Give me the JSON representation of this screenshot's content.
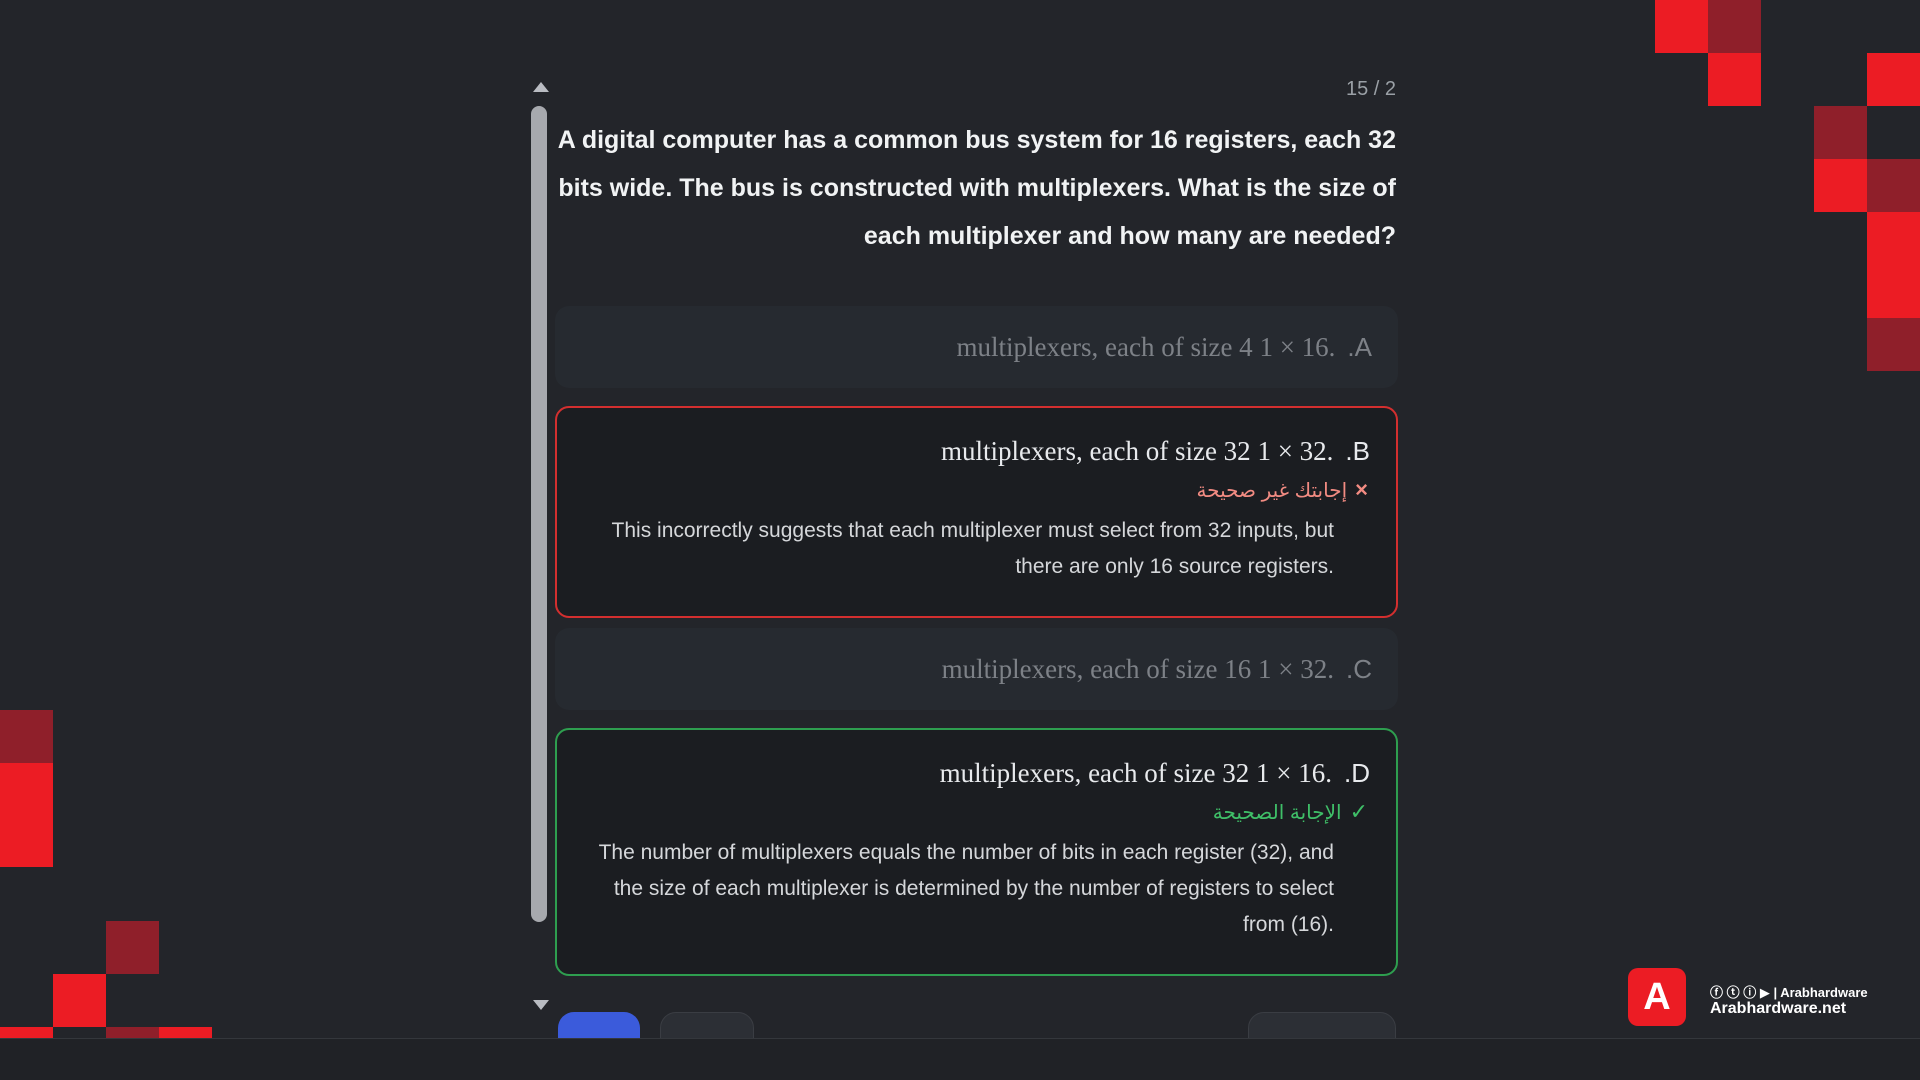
{
  "quiz": {
    "counter": "15 / 2",
    "question": "A digital computer has a common bus system for 16 registers, each 32 bits wide. The bus is constructed with multiplexers. What is the size of each multiplexer and how many are needed?",
    "options": [
      {
        "letter": "A.",
        "text": ".16 × 1 multiplexers, each of size 4",
        "state": "neutral"
      },
      {
        "letter": "B.",
        "text": ".32 × 1 multiplexers, each of size 32",
        "state": "wrong",
        "verdict": "إجابتك غير صحيحة",
        "explanation": "This incorrectly suggests that each multiplexer must select from 32 inputs, but there are only 16 source registers."
      },
      {
        "letter": "C.",
        "text": ".32 × 1 multiplexers, each of size 16",
        "state": "neutral"
      },
      {
        "letter": "D.",
        "text": ".16 × 1 multiplexers, each of size 32",
        "state": "correct",
        "verdict": "الإجابة الصحيحة",
        "explanation": "The number of multiplexers equals the number of bits in each register (32), and the size of each multiplexer is determined by the number of registers to select from (16)."
      }
    ]
  },
  "icons": {
    "wrong": "×",
    "correct": "✓"
  },
  "brand": {
    "logo_glyph": "A",
    "social": "ⓕ ⓣ ⓘ ▶ | Arabhardware",
    "site": "Arabhardware.net"
  },
  "colors": {
    "accent_red": "#ec1c24",
    "wrong_border": "#d32f2f",
    "correct_border": "#2e9e4f",
    "primary_button": "#3b5bdb"
  }
}
